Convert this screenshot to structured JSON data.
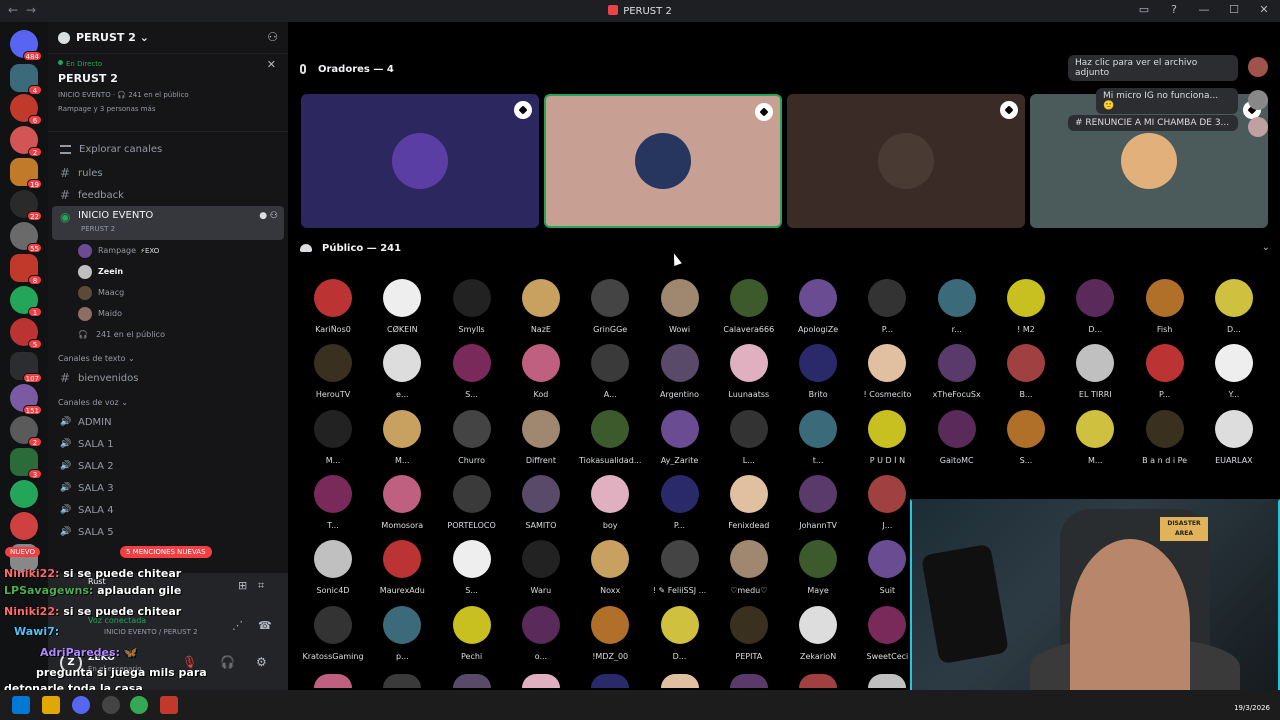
{
  "window": {
    "title": "PERUST 2"
  },
  "guild": {
    "name": "PERUST 2"
  },
  "event": {
    "live_label": "En Directo",
    "name": "PERUST 2",
    "meta": "INICIO EVENTO · 🎧 241 en el público",
    "people": "Rampage y 3 personas más"
  },
  "sidebar": {
    "browse_label": "Explorar canales",
    "channels": [
      "rules",
      "feedback"
    ],
    "stage_channel": {
      "name": "INICIO EVENTO",
      "sub": "PERUST 2"
    },
    "voice_users": [
      {
        "name": "Rampage",
        "tag": "⚡EXO",
        "color": "#6a4c93"
      },
      {
        "name": "Zeein",
        "tag": "",
        "color": "#c0c0c0"
      },
      {
        "name": "Maacg",
        "tag": "",
        "color": "#5b4a3a"
      },
      {
        "name": "Maido",
        "tag": "",
        "color": "#8d6e63"
      }
    ],
    "audience_count": "241 en el público",
    "text_category": "Canales de texto",
    "text_channels": [
      "bienvenidos"
    ],
    "voice_category": "Canales de voz",
    "voice_channels": [
      "ADMIN",
      "SALA 1",
      "SALA 2",
      "SALA 3",
      "SALA 4",
      "SALA 5"
    ],
    "new_badge": "NUEVO",
    "mentions_badge": "5 MENCIONES NUEVAS"
  },
  "rail_badges": [
    "484",
    "4",
    "6",
    "2",
    "19",
    "22",
    "55",
    "8",
    "1",
    "5",
    "107",
    "151",
    "2",
    "3"
  ],
  "voice_panel": {
    "status": "Voz conectada",
    "location": "INICIO EVENTO / PERUST 2",
    "activity": "Rust"
  },
  "user_panel": {
    "initial": "Z",
    "name": "ZEKO",
    "status": "En el escenario"
  },
  "chat_overlay": [
    {
      "who": "Niniki22:",
      "text": "si se puede chitear",
      "color": "red"
    },
    {
      "who": "LPSavagewns:",
      "text": "aplaudan gile",
      "color": "green"
    },
    {
      "who": "Niniki22:",
      "text": "si se puede chitear",
      "color": "red"
    },
    {
      "who": "Wawi7:",
      "text": "",
      "color": "blue"
    },
    {
      "who": "AdriParedes:",
      "text": "🦋",
      "color": "purple"
    },
    {
      "who": "",
      "text": "pregunta si juega mils para",
      "color": "green"
    },
    {
      "who": "",
      "text": "detonarle toda la casa",
      "color": "red"
    }
  ],
  "stage": {
    "speakers_label": "Oradores — 4",
    "audience_label": "Público — 241",
    "speakers": [
      {
        "bg": "#2d2760",
        "color": "#5b3ea3",
        "talking": false
      },
      {
        "bg": "#c79f93",
        "color": "#27365f",
        "talking": true
      },
      {
        "bg": "#3a2b26",
        "color": "#4a3a34",
        "talking": false
      },
      {
        "bg": "#4b5a5a",
        "color": "#e2b07a",
        "talking": false
      }
    ],
    "audience": [
      [
        "KariÑos0",
        "CØKEIN",
        "Smylls",
        "NazE",
        "GrinGGe",
        "Wowi",
        "Calavera666",
        "ApologiZe",
        "P...",
        "r...",
        "! M2",
        "D...",
        "Fish",
        "D..."
      ],
      [
        "HerouTV",
        "e...",
        "S...",
        "Kod",
        "A...",
        "Argentino",
        "Luunaatss",
        "Brito",
        "! Cosmecito",
        "xTheFocuSx",
        "B...",
        "EL TIRRI",
        "P...",
        "Y..."
      ],
      [
        "M...",
        "M...",
        "Churro",
        "Diffrent",
        "Tiokasualidad...",
        "Ay_Zarite",
        "L...",
        "t...",
        "P U D Í N",
        "GaitoMC",
        "S...",
        "M...",
        "B a n d i Pe",
        "EUARLAX"
      ],
      [
        "T...",
        "Momosora",
        "PORTELOCO",
        "SAMITO",
        "boy",
        "P...",
        "Fenixdead",
        "JohannTV",
        "J..."
      ],
      [
        "Sonic4D",
        "MaurexAdu",
        "S...",
        "Waru",
        "Noxx",
        "! ✎ FeliiSSJ ...",
        "♡medu♡",
        "Maye",
        "Suit"
      ],
      [
        "KratossGaming",
        "p...",
        "Pechi",
        "o...",
        "!MDZ_00",
        "D...",
        "PEPITA",
        "ZekarioN",
        "SweetCeci"
      ]
    ],
    "avatar_colors": [
      "#b33",
      "#eee",
      "#222",
      "#c8a060",
      "#444",
      "#a08870",
      "#3c5a2c",
      "#6a4c93",
      "#333",
      "#3b6b7a",
      "#c8c020",
      "#5a2a5a",
      "#b0702a",
      "#d0c040",
      "#3a3020",
      "#ddd",
      "#7a2a5a",
      "#c06080",
      "#3a3a3a",
      "#5a4a6a",
      "#e0b0c0",
      "#2a2a6a",
      "#e0c0a0",
      "#5a3a6a",
      "#a04040",
      "#c0c0c0"
    ]
  },
  "toasts": [
    {
      "text": "Haz clic para ver el archivo adjunto"
    },
    {
      "text": "Mi micro IG no funciona... 🙁"
    },
    {
      "text": "# RENUNCIE A MI CHAMBA DE 3..."
    }
  ],
  "webcam": {
    "sign_text": "DISASTER AREA"
  },
  "taskbar": {
    "date": "19/3/2026"
  }
}
